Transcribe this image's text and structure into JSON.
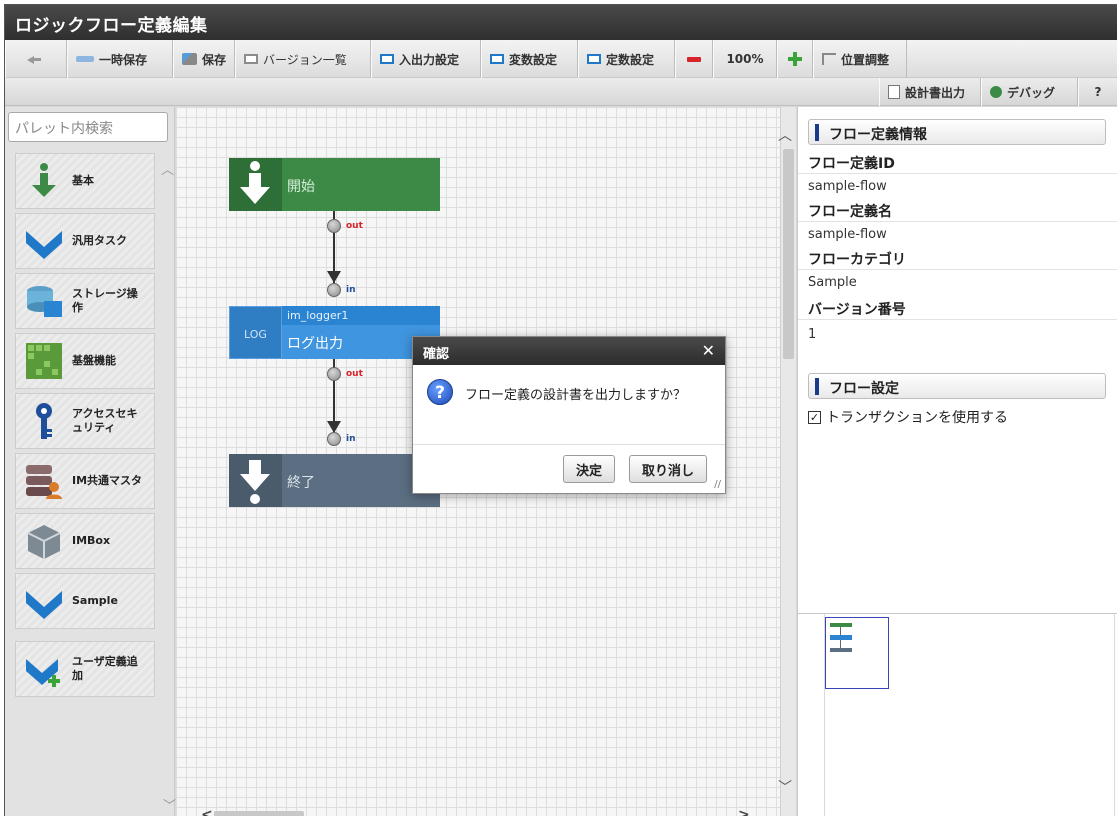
{
  "app": {
    "title": "ロジックフロー定義編集"
  },
  "toolbar": {
    "back_icon": "back-arrow-icon",
    "temp_save": "一時保存",
    "save": "保存",
    "versions": "バージョン一覧",
    "io_settings": "入出力設定",
    "var_settings": "変数設定",
    "const_settings": "定数設定",
    "zoom": "100%",
    "position_adjust": "位置調整",
    "export_doc": "設計書出力",
    "debug": "デバッグ",
    "help": "?"
  },
  "palette": {
    "search_placeholder": "パレット内検索",
    "items": [
      {
        "label": "基本",
        "icon": "green-down-arrow-icon"
      },
      {
        "label": "汎用タスク",
        "icon": "blue-down-arrow-icon"
      },
      {
        "label": "ストレージ操作",
        "icon": "storage-icon"
      },
      {
        "label": "基盤機能",
        "icon": "grid-platform-icon"
      },
      {
        "label": "アクセスセキュリティ",
        "icon": "key-icon"
      },
      {
        "label": "IM共通マスタ",
        "icon": "database-user-icon"
      },
      {
        "label": "IMBox",
        "icon": "box-icon"
      },
      {
        "label": "Sample",
        "icon": "blue-down-arrow-icon"
      },
      {
        "label": "ユーザ定義追加",
        "icon": "add-user-task-icon"
      }
    ]
  },
  "canvas": {
    "nodes": [
      {
        "id": "start",
        "label": "開始",
        "color": "#3c8a46"
      },
      {
        "id": "logger",
        "title": "im_logger1",
        "label": "ログ出力",
        "icon_text": "LOG",
        "color": "#2b84d2"
      },
      {
        "id": "end",
        "label": "終了",
        "color": "#5b6e82"
      }
    ],
    "ports": {
      "out": "out",
      "in": "in"
    }
  },
  "properties": {
    "flow_info_header": "フロー定義情報",
    "fields": [
      {
        "label": "フロー定義ID",
        "value": "sample-flow"
      },
      {
        "label": "フロー定義名",
        "value": "sample-flow"
      },
      {
        "label": "フローカテゴリ",
        "value": "Sample"
      },
      {
        "label": "バージョン番号",
        "value": "1"
      }
    ],
    "flow_settings_header": "フロー設定",
    "use_transaction": {
      "label": "トランザクションを使用する",
      "checked": true
    }
  },
  "dialog": {
    "title": "確認",
    "message": "フロー定義の設計書を出力しますか？",
    "ok": "決定",
    "cancel": "取り消し"
  },
  "colors": {
    "accent": "#1f78c8",
    "title_bar": "#3a3a3a",
    "node_green": "#3c8a46",
    "node_blue": "#2b84d2",
    "node_slate": "#5b6e82"
  }
}
